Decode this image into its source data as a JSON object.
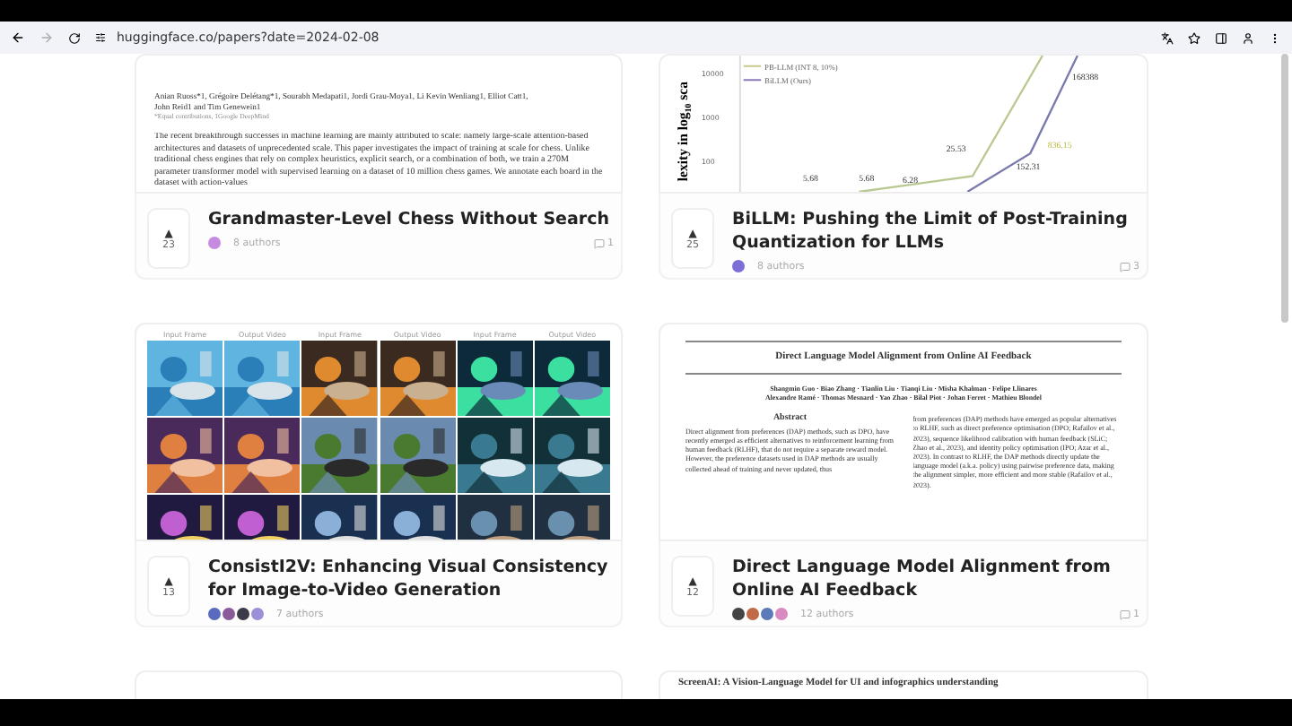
{
  "browser": {
    "url": "huggingface.co/papers?date=2024-02-08"
  },
  "papers": [
    {
      "title": "Grandmaster-Level Chess Without Search",
      "upvote_icon": "▲",
      "upvotes": "23",
      "authors": "8 authors",
      "avatars": [
        {
          "color": "#c58be0"
        }
      ],
      "comments": "1",
      "thumbnail": {
        "kind": "document",
        "authors": [
          "Anian Ruoss*1, Grégoire Delétang*1, Sourabh Medapati1, Jordi Grau-Moya1, Li Kevin Wenliang1, Elliot Catt1,",
          "John Reid1 and Tim Genewein1"
        ],
        "note": "*Equal contributions, 1Google DeepMind",
        "abstract": "The recent breakthrough successes in machine learning are mainly attributed to scale: namely large-scale attention-based architectures and datasets of unprecedented scale. This paper investigates the impact of training at scale for chess. Unlike traditional chess engines that rely on complex heuristics, explicit search, or a combination of both, we train a 270M parameter transformer model with supervised learning on a dataset of 10 million chess games. We annotate each board in the dataset with action-values"
      }
    },
    {
      "title": "BiLLM: Pushing the Limit of Post-Training Quantization for LLMs",
      "upvote_icon": "▲",
      "upvotes": "25",
      "authors": "8 authors",
      "avatars": [
        {
          "color": "#7b6fd6"
        }
      ],
      "comments": "3",
      "thumbnail": {
        "kind": "chart",
        "axis_label": "lexity in log$_{10}$ sca",
        "ticks": [
          "10000",
          "1000",
          "100"
        ],
        "legend": [
          "PB-LLM (INT 8, 10%)",
          "BiLLM (Ours)"
        ],
        "labels": [
          "5.68",
          "5.68",
          "6.28",
          "25.53",
          "152.31",
          "836.15",
          "168388"
        ]
      }
    },
    {
      "title": "ConsistI2V: Enhancing Visual Consistency for Image-to-Video Generation",
      "upvote_icon": "▲",
      "upvotes": "13",
      "authors": "7 authors",
      "avatars": [
        {
          "color": "#5a6bbf"
        },
        {
          "color": "#8a5a9a"
        },
        {
          "color": "#3a3a4a"
        },
        {
          "color": "#9b8fd8"
        }
      ],
      "thumbnail": {
        "kind": "image_grid",
        "headers": [
          "Input Frame",
          "Output Video",
          "Input Frame",
          "Output Video",
          "Input Frame",
          "Output Video"
        ],
        "cells": [
          {
            "kind": "picture"
          },
          {
            "kind": "picture"
          },
          {
            "kind": "picture"
          },
          {
            "kind": "picture"
          },
          {
            "kind": "picture"
          },
          {
            "kind": "picture"
          },
          {
            "kind": "picture"
          },
          {
            "kind": "picture"
          },
          {
            "kind": "picture"
          },
          {
            "kind": "picture"
          },
          {
            "kind": "picture"
          },
          {
            "kind": "picture"
          },
          {
            "kind": "picture"
          },
          {
            "kind": "picture"
          },
          {
            "kind": "picture"
          },
          {
            "kind": "picture"
          },
          {
            "kind": "picture"
          },
          {
            "kind": "picture"
          }
        ]
      }
    },
    {
      "title": "Direct Language Model Alignment from Online AI Feedback",
      "upvote_icon": "▲",
      "upvotes": "12",
      "authors": "12 authors",
      "avatars": [
        {
          "color": "#444444"
        },
        {
          "color": "#c06a4a"
        },
        {
          "color": "#5a7ab8"
        },
        {
          "color": "#d98ac0"
        }
      ],
      "comments": "1",
      "thumbnail": {
        "kind": "paper",
        "title": "Direct Language Model Alignment from Online AI Feedback",
        "authors": [
          "Shangmin Guo · Biao Zhang · Tianlin Liu · Tianqi Liu · Misha Khalman · Felipe Llinares",
          "Alexandre Ramé · Thomas Mesnard · Yao Zhao · Bilal Piot · Johan Ferret · Mathieu Blondel"
        ],
        "heading": "Abstract",
        "left": "Direct alignment from preferences (DAP) methods, such as DPO, have recently emerged as efficient alternatives to reinforcement learning from human feedback (RLHF), that do not require a separate reward model. However, the preference datasets used in DAP methods are usually collected ahead of training and never updated, thus",
        "right": "from preferences (DAP) methods have emerged as popular alternatives to RLHF, such as direct preference optimisation (DPO; Rafailov et al., 2023), sequence likelihood calibration with human feedback (SLiC; Zhao et al., 2023), and identity policy optimisation (IPO; Azar et al., 2023). In contrast to RLHF, the DAP methods directly update the language model (a.k.a. policy) using pairwise preference data, making the alignment simpler, more efficient and more stable (Rafailov et al., 2023)."
      }
    },
    {
      "thumbnail": {
        "kind": "blank"
      }
    },
    {
      "thumbnail": {
        "kind": "heading",
        "title": "ScreenAI: A Vision-Language Model for UI and infographics understanding"
      }
    }
  ]
}
